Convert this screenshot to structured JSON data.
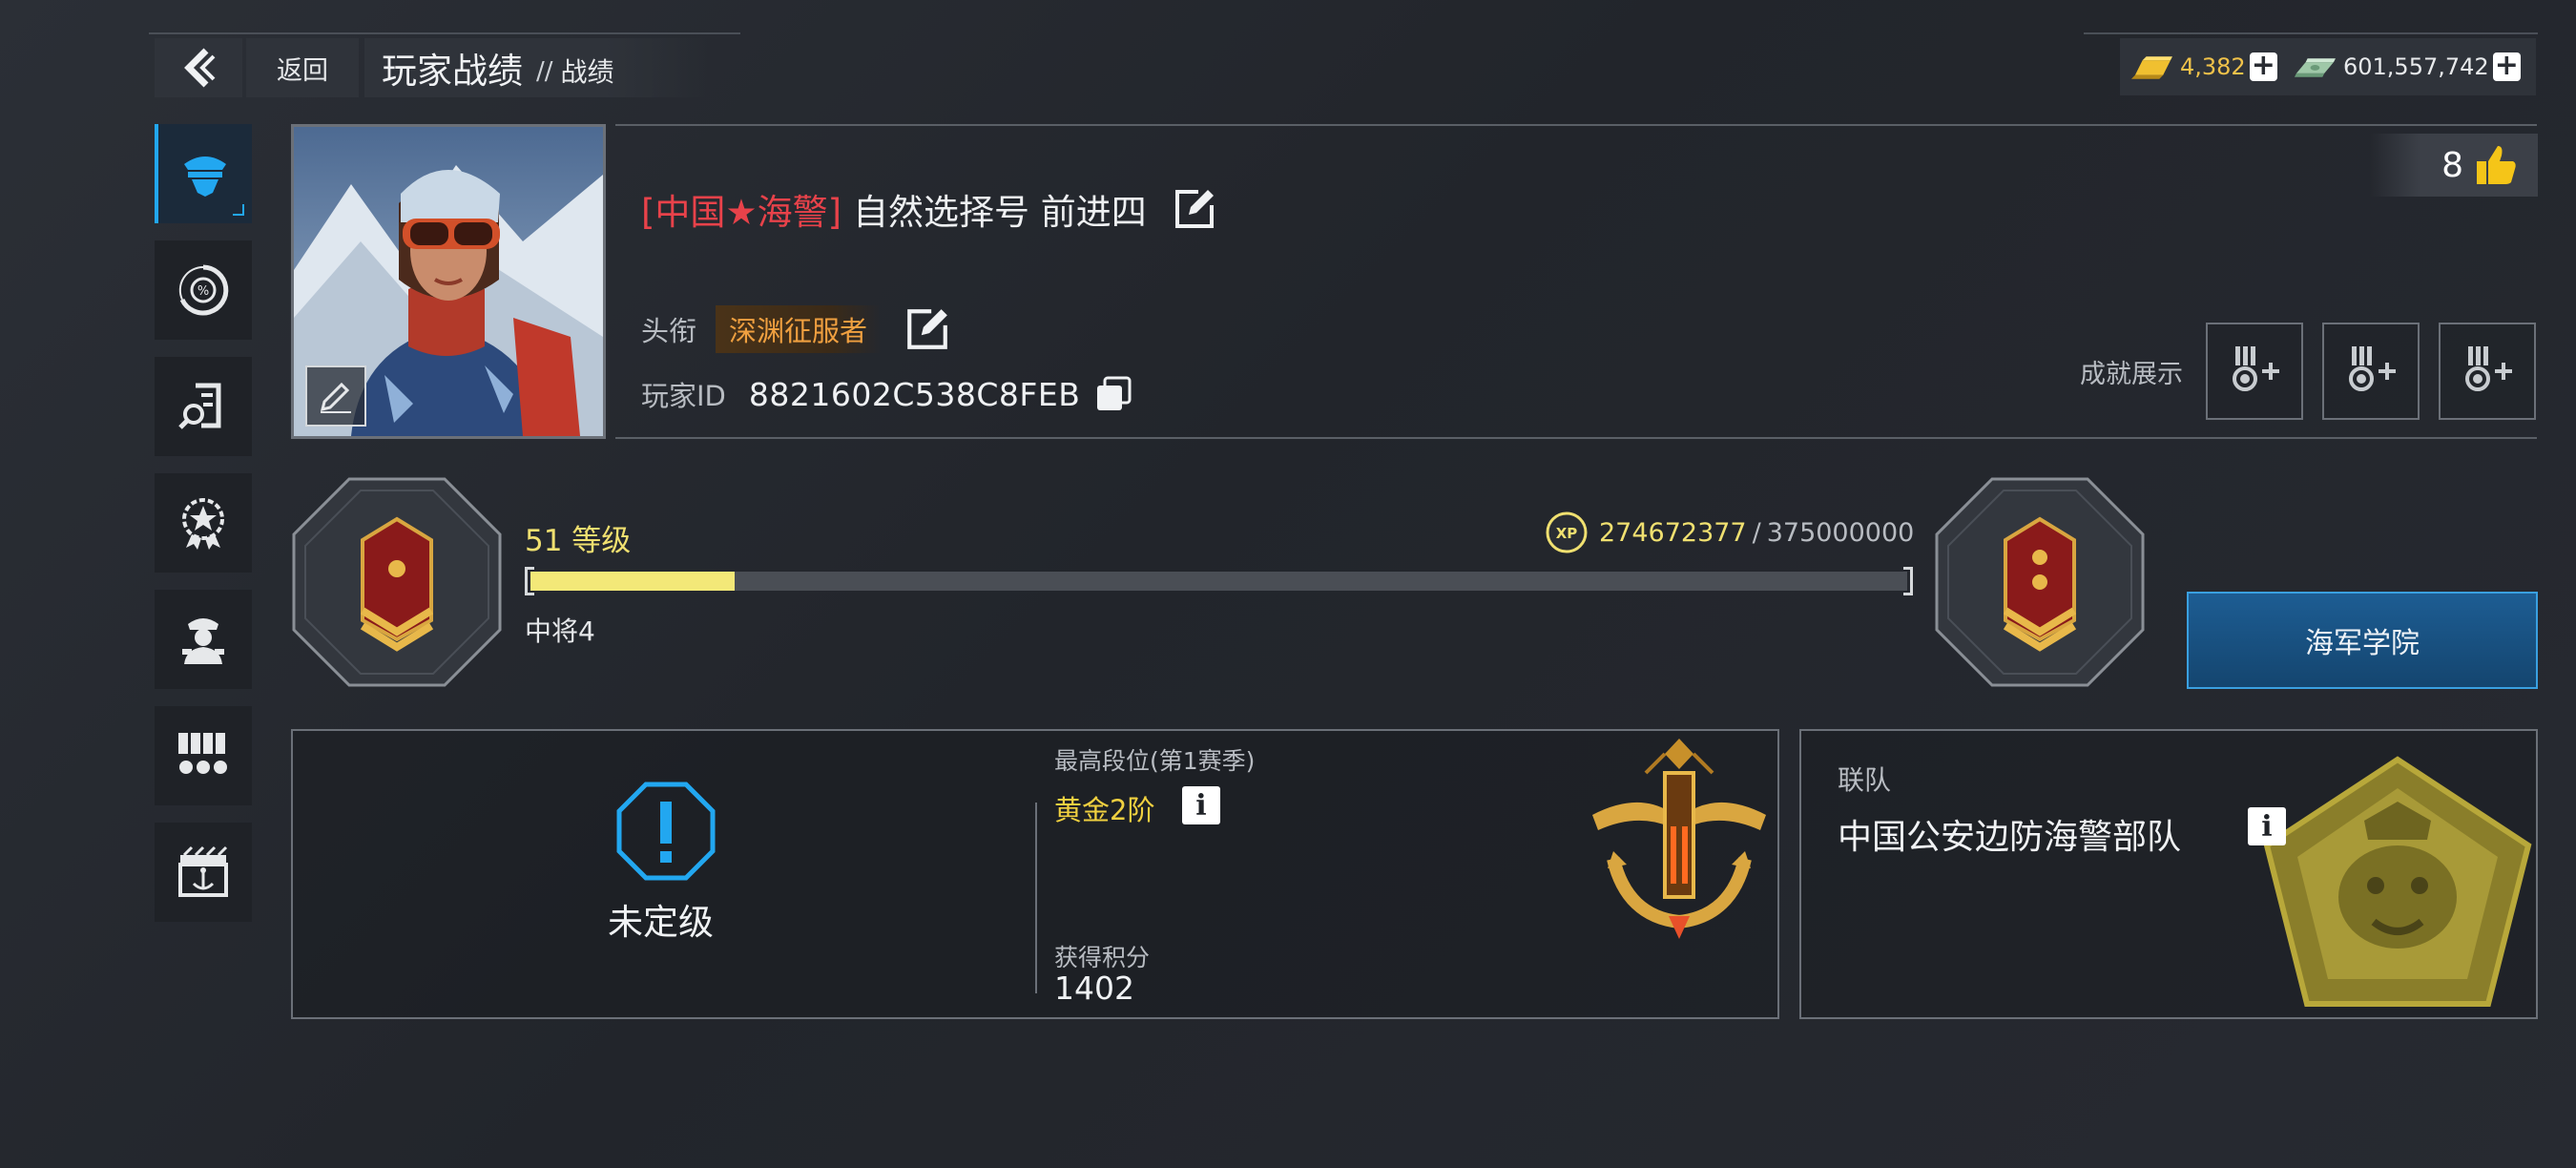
{
  "header": {
    "back_label": "返回",
    "title": "玩家战绩",
    "separator": "//",
    "subtitle": "战绩"
  },
  "currency": {
    "gold": "4,382",
    "cash": "601,557,742"
  },
  "sidebar": {
    "items": [
      {
        "name": "profile-tab",
        "icon": "officer-cap-icon",
        "active": true
      },
      {
        "name": "stats-tab",
        "icon": "percent-gauge-icon",
        "active": false
      },
      {
        "name": "records-tab",
        "icon": "magnifier-report-icon",
        "active": false
      },
      {
        "name": "achievements-tab",
        "icon": "star-medal-icon",
        "active": false
      },
      {
        "name": "commander-tab",
        "icon": "admiral-portrait-icon",
        "active": false
      },
      {
        "name": "medals-tab",
        "icon": "medal-rack-icon",
        "active": false
      },
      {
        "name": "harbor-tab",
        "icon": "anchor-gate-icon",
        "active": false
      }
    ]
  },
  "profile": {
    "name_tag": "[中国★海警]",
    "name": "自然选择号 前进四",
    "title_label": "头衔",
    "title": "深渊征服者",
    "id_label": "玩家ID",
    "id": "8821602C538C8FEB",
    "likes": "8",
    "achievements_label": "成就展示"
  },
  "level": {
    "label": "51 等级",
    "level": 51,
    "rank_name": "中将4",
    "xp_current": "274672377",
    "xp_total": "375000000",
    "xp_sep": "/",
    "progress": 0.1486
  },
  "academy_button": "海军学院",
  "ranked": {
    "status": "未定级",
    "best_label": "最高段位(第1赛季)",
    "best_value": "黄金2阶",
    "points_label": "获得积分",
    "points": "1402"
  },
  "team": {
    "label": "联队",
    "name": "中国公安边防海警部队"
  },
  "colors": {
    "accent_blue": "#22a7f0",
    "name_tag_red": "#e8424a",
    "xp_yellow": "#f3e878",
    "title_orange": "#f0a040",
    "gold_rank": "#f0d040"
  }
}
